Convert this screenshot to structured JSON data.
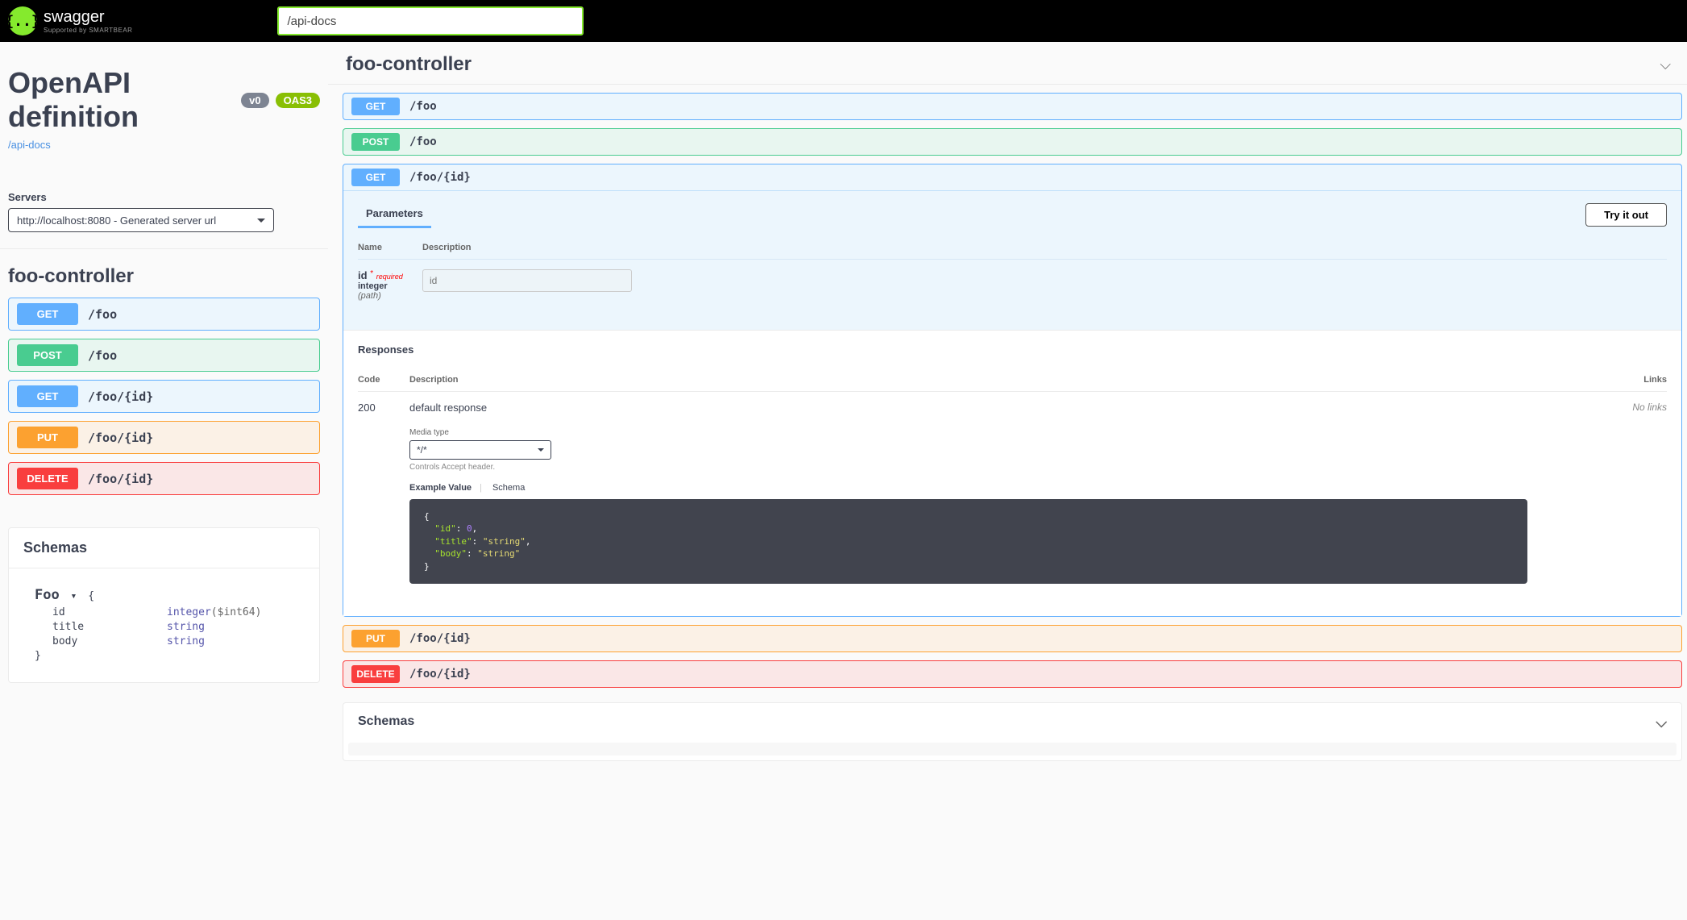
{
  "topbar": {
    "brand": "swagger",
    "supported": "Supported by SMARTBEAR",
    "url_input": "/api-docs"
  },
  "info": {
    "title": "OpenAPI definition",
    "version": "v0",
    "oas": "OAS3",
    "link": "/api-docs"
  },
  "servers": {
    "label": "Servers",
    "selected": "http://localhost:8080 - Generated server url"
  },
  "left": {
    "tag": "foo-controller",
    "ops": [
      {
        "method": "GET",
        "path": "/foo"
      },
      {
        "method": "POST",
        "path": "/foo"
      },
      {
        "method": "GET",
        "path": "/foo/{id}"
      },
      {
        "method": "PUT",
        "path": "/foo/{id}"
      },
      {
        "method": "DELETE",
        "path": "/foo/{id}"
      }
    ],
    "schemas": {
      "title": "Schemas",
      "model_name": "Foo",
      "props": [
        {
          "name": "id",
          "type": "integer",
          "fmt": "($int64)"
        },
        {
          "name": "title",
          "type": "string",
          "fmt": ""
        },
        {
          "name": "body",
          "type": "string",
          "fmt": ""
        }
      ]
    }
  },
  "right": {
    "tag": "foo-controller",
    "ops": {
      "get_foo": {
        "method": "GET",
        "path": "/foo"
      },
      "post_foo": {
        "method": "POST",
        "path": "/foo"
      },
      "get_foo_id": {
        "method": "GET",
        "path": "/foo/{id}"
      },
      "put_foo_id": {
        "method": "PUT",
        "path": "/foo/{id}"
      },
      "delete_foo_id": {
        "method": "DELETE",
        "path": "/foo/{id}"
      }
    },
    "expanded": {
      "parameters_title": "Parameters",
      "try_it": "Try it out",
      "th_name": "Name",
      "th_desc": "Description",
      "p_name": "id",
      "p_req": "required",
      "p_type": "integer",
      "p_in": "(path)",
      "p_placeholder": "id",
      "responses_title": "Responses",
      "th_code": "Code",
      "th_desc2": "Description",
      "th_links": "Links",
      "code": "200",
      "desc": "default response",
      "no_links": "No links",
      "mt_label": "Media type",
      "mt_value": "*/*",
      "mt_hint": "Controls Accept header.",
      "ev": "Example Value",
      "sch": "Schema",
      "example": "{\n  \"id\": 0,\n  \"title\": \"string\",\n  \"body\": \"string\"\n}"
    },
    "schemas_title": "Schemas"
  }
}
